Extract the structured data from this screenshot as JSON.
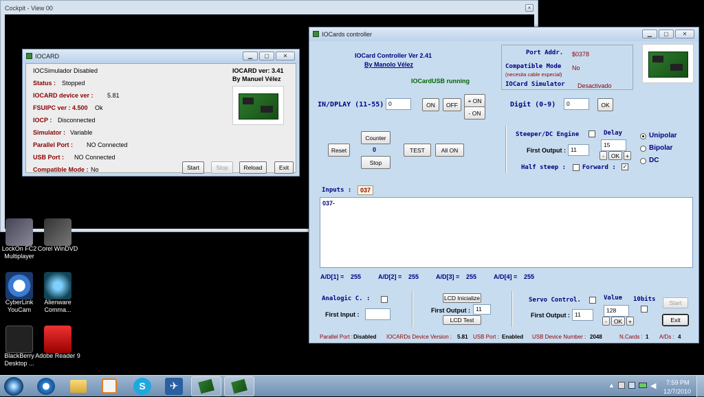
{
  "cockpit": {
    "title": "Cockpit - View 00"
  },
  "iocard": {
    "title": "IOCARD",
    "simulator_status": "IOCSimulador Disabled",
    "version_line": "IOCARD ver: 3.41",
    "author": "By Manuel Vélez",
    "rows": [
      {
        "label": "Status :",
        "value": "Stopped"
      },
      {
        "label": "IOCARD device ver :",
        "value": "5.81"
      },
      {
        "label": "FSUIPC ver : 4.500",
        "value": "Ok"
      },
      {
        "label": "IOCP :",
        "value": "Disconnected"
      },
      {
        "label": "Simulator :",
        "value": "Variable"
      },
      {
        "label": "Parallel Port :",
        "value": "NO Connected"
      },
      {
        "label": "USB Port :",
        "value": "NO Connected"
      },
      {
        "label": "Compatible Mode :",
        "value": "No"
      }
    ],
    "buttons": {
      "start": "Start",
      "stop": "Stop",
      "reload": "Reload",
      "exit": "Exit"
    }
  },
  "controller": {
    "title": "IOCards controller",
    "header": {
      "name": "IOCard Controller Ver 2.41",
      "author": "By Manolo Vélez",
      "usb_status": "IOCardUSB running"
    },
    "info": {
      "port_label": "Port Addr.",
      "port_value": "$0378",
      "compat_label": "Compatible Mode",
      "compat_value": "No",
      "compat_note": "(necesita cable especial)",
      "sim_label": "IOCard Simulator",
      "sim_value": "Desactivado"
    },
    "indisplay": {
      "label": "IN/DPLAY (11-55)",
      "value": "0",
      "on": "ON",
      "off": "OFF",
      "plus_on": "+ ON",
      "minus_on": "- ON"
    },
    "digit": {
      "label": "Digit (0-9)",
      "value": "0",
      "ok": "OK"
    },
    "counter": {
      "label": "Counter",
      "value": "0",
      "reset": "Reset",
      "stop": "Stop",
      "test": "TEST",
      "all_on": "All ON"
    },
    "stepper": {
      "label": "Steeper/DC Engine",
      "delay_label": "Delay",
      "first_output_label": "First Output :",
      "first_output": "11",
      "delay": "15",
      "minus": "-",
      "ok": "OK",
      "plus": "+",
      "half": "Half steep :",
      "forward": "Forward :",
      "check": "✓"
    },
    "motor": {
      "unipolar": "Unipolar",
      "bipolar": "Bipolar",
      "dc": "DC"
    },
    "inputs": {
      "label": "Inputs :",
      "badge": "037",
      "log": "037-"
    },
    "ad": [
      {
        "label": "A/D[1] =",
        "value": "255"
      },
      {
        "label": "A/D[2] =",
        "value": "255"
      },
      {
        "label": "A/D[3] =",
        "value": "255"
      },
      {
        "label": "A/D[4] =",
        "value": "255"
      }
    ],
    "analogic": {
      "label": "Analogic C. :",
      "first_input": "First Input :",
      "value": ""
    },
    "lcd": {
      "init": "LCD Inicialize",
      "first_output": "First Output :",
      "value": "11",
      "test": "LCD Test"
    },
    "servo": {
      "label": "Servo Control.",
      "value_label": "Value",
      "bits": "10bits",
      "first_output": "First Output :",
      "output": "11",
      "value": "128",
      "minus": "-",
      "ok": "OK",
      "plus": "+",
      "start": "Start",
      "exit": "Exit"
    },
    "status": {
      "parallel_label": "Parallel Port :",
      "parallel_value": "Disabled",
      "device_label": "IOCARDs Device Version :",
      "device_value": "5.81",
      "usb_label": "USB Port :",
      "usb_value": "Enabled",
      "usbnum_label": "USB Device Number :",
      "usbnum_value": "2048",
      "ncards_label": "N.Cards :",
      "ncards_value": "1",
      "ads_label": "A/Ds :",
      "ads_value": "4"
    }
  },
  "desktop": {
    "icons": [
      {
        "name": "lockon-icon",
        "label": "LockOn FC2 Multiplayer"
      },
      {
        "name": "corel-icon",
        "label": "Corel WinDVD"
      },
      {
        "name": "cyberlink-icon",
        "label": "CyberLink YouCam"
      },
      {
        "name": "alienware-icon",
        "label": "Alienware Comma..."
      },
      {
        "name": "blackberry-icon",
        "label": "BlackBerry Desktop ..."
      },
      {
        "name": "adobe-icon",
        "label": "Adobe Reader 9"
      }
    ]
  },
  "taskbar": {
    "time": "7:59 PM",
    "date": "12/7/2010"
  }
}
